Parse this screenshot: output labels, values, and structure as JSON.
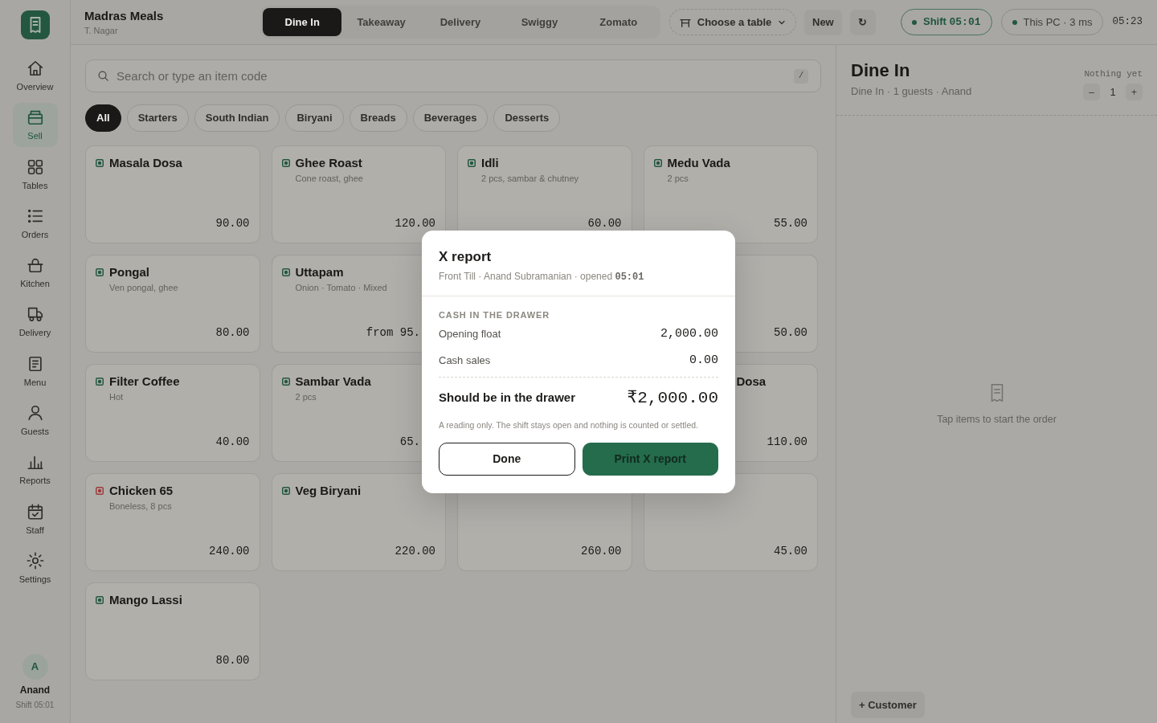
{
  "brand": {
    "name": "Madras Meals",
    "location": "T. Nagar"
  },
  "sidebar": {
    "items": [
      {
        "label": "Overview",
        "selected": false
      },
      {
        "label": "Sell",
        "selected": true
      },
      {
        "label": "Tables",
        "selected": false
      },
      {
        "label": "Orders",
        "selected": false
      },
      {
        "label": "Kitchen",
        "selected": false
      },
      {
        "label": "Delivery",
        "selected": false
      },
      {
        "label": "Menu",
        "selected": false
      },
      {
        "label": "Guests",
        "selected": false
      },
      {
        "label": "Reports",
        "selected": false
      },
      {
        "label": "Staff",
        "selected": false
      },
      {
        "label": "Settings",
        "selected": false
      }
    ],
    "user": {
      "initial": "A",
      "name": "Anand",
      "shift": "Shift 05:01"
    }
  },
  "order_types": [
    {
      "label": "Dine In",
      "selected": true
    },
    {
      "label": "Takeaway",
      "selected": false
    },
    {
      "label": "Delivery",
      "selected": false
    },
    {
      "label": "Swiggy",
      "selected": false
    },
    {
      "label": "Zomato",
      "selected": false
    }
  ],
  "table_picker": {
    "label": "Choose a table"
  },
  "toolbar_buttons": [
    {
      "label": "New"
    },
    {
      "label": "↻"
    }
  ],
  "status": [
    {
      "kind": "shift",
      "label": "Shift",
      "value": "05:01"
    },
    {
      "kind": "connection",
      "label": "This PC · 3 ms"
    }
  ],
  "clock": "05:23",
  "search": {
    "placeholder": "Search or type an item code",
    "shortcut": "/"
  },
  "categories": [
    {
      "label": "All",
      "selected": true
    },
    {
      "label": "Starters",
      "selected": false
    },
    {
      "label": "South Indian",
      "selected": false
    },
    {
      "label": "Biryani",
      "selected": false
    },
    {
      "label": "Breads",
      "selected": false
    },
    {
      "label": "Beverages",
      "selected": false
    },
    {
      "label": "Desserts",
      "selected": false
    }
  ],
  "items": [
    {
      "name": "Masala Dosa",
      "price": "90.00",
      "color": "#23573f"
    },
    {
      "name": "Ghee Roast",
      "description": "Cone roast, ghee",
      "price": "120.00",
      "color": "#23573f"
    },
    {
      "name": "Idli",
      "description": "2 pcs, sambar & chutney",
      "price": "60.00",
      "color": "#23573f"
    },
    {
      "name": "Medu Vada",
      "description": "2 pcs",
      "price": "55.00",
      "color": "#23573f"
    },
    {
      "name": "Pongal",
      "description": "Ven pongal, ghee",
      "price": "80.00",
      "color": "#23573f"
    },
    {
      "name": "Uttapam",
      "description": "Onion · Tomato · Mixed",
      "price": "from 95.",
      "color": "#23573f"
    },
    {
      "price": "50.00"
    },
    {
      "name": "Filter Coffee",
      "description": "Hot",
      "price": "40.00",
      "color": "#23573f"
    },
    {
      "name": "Sambar Vada",
      "description": "2 pcs",
      "price": "65.",
      "color": "#23573f"
    },
    {
      "name": "Dosa",
      "price": "110.00"
    },
    {
      "name": "Chicken 65",
      "description": "Boneless, 8 pcs",
      "price": "240.00",
      "color": "#9c3c3c"
    },
    {
      "name": "Veg Biryani",
      "price": "220.00",
      "color": "#23573f"
    },
    {
      "price": "260.00"
    },
    {
      "price": "45.00"
    },
    {
      "name": "Mango Lassi",
      "price": "80.00",
      "color": "#23573f"
    }
  ],
  "order_panel": {
    "title": "Dine In",
    "subtitle": "Dine In · 1 guests · Anand",
    "total": "Nothing yet",
    "decrement": "–",
    "guests": "1",
    "increment": "+",
    "empty_message": "Tap items to start the order",
    "customer_button": "+ Customer"
  },
  "dialog": {
    "title": "X report",
    "subtitle": "Front Till · Anand Subramanian · opened **05:01**",
    "section": "CASH IN THE DRAWER",
    "rows": [
      {
        "label": "Opening float",
        "value": "2,000.00"
      },
      {
        "label": "Cash sales",
        "value": "0.00"
      }
    ],
    "total": {
      "label": "Should be in the drawer",
      "value": "₹2,000.00"
    },
    "note": "A reading only. The shift stays open and nothing is counted or settled.",
    "buttons": [
      {
        "label": "Done",
        "kind": "secondary"
      },
      {
        "label": "Print X report",
        "kind": "primary"
      }
    ]
  }
}
